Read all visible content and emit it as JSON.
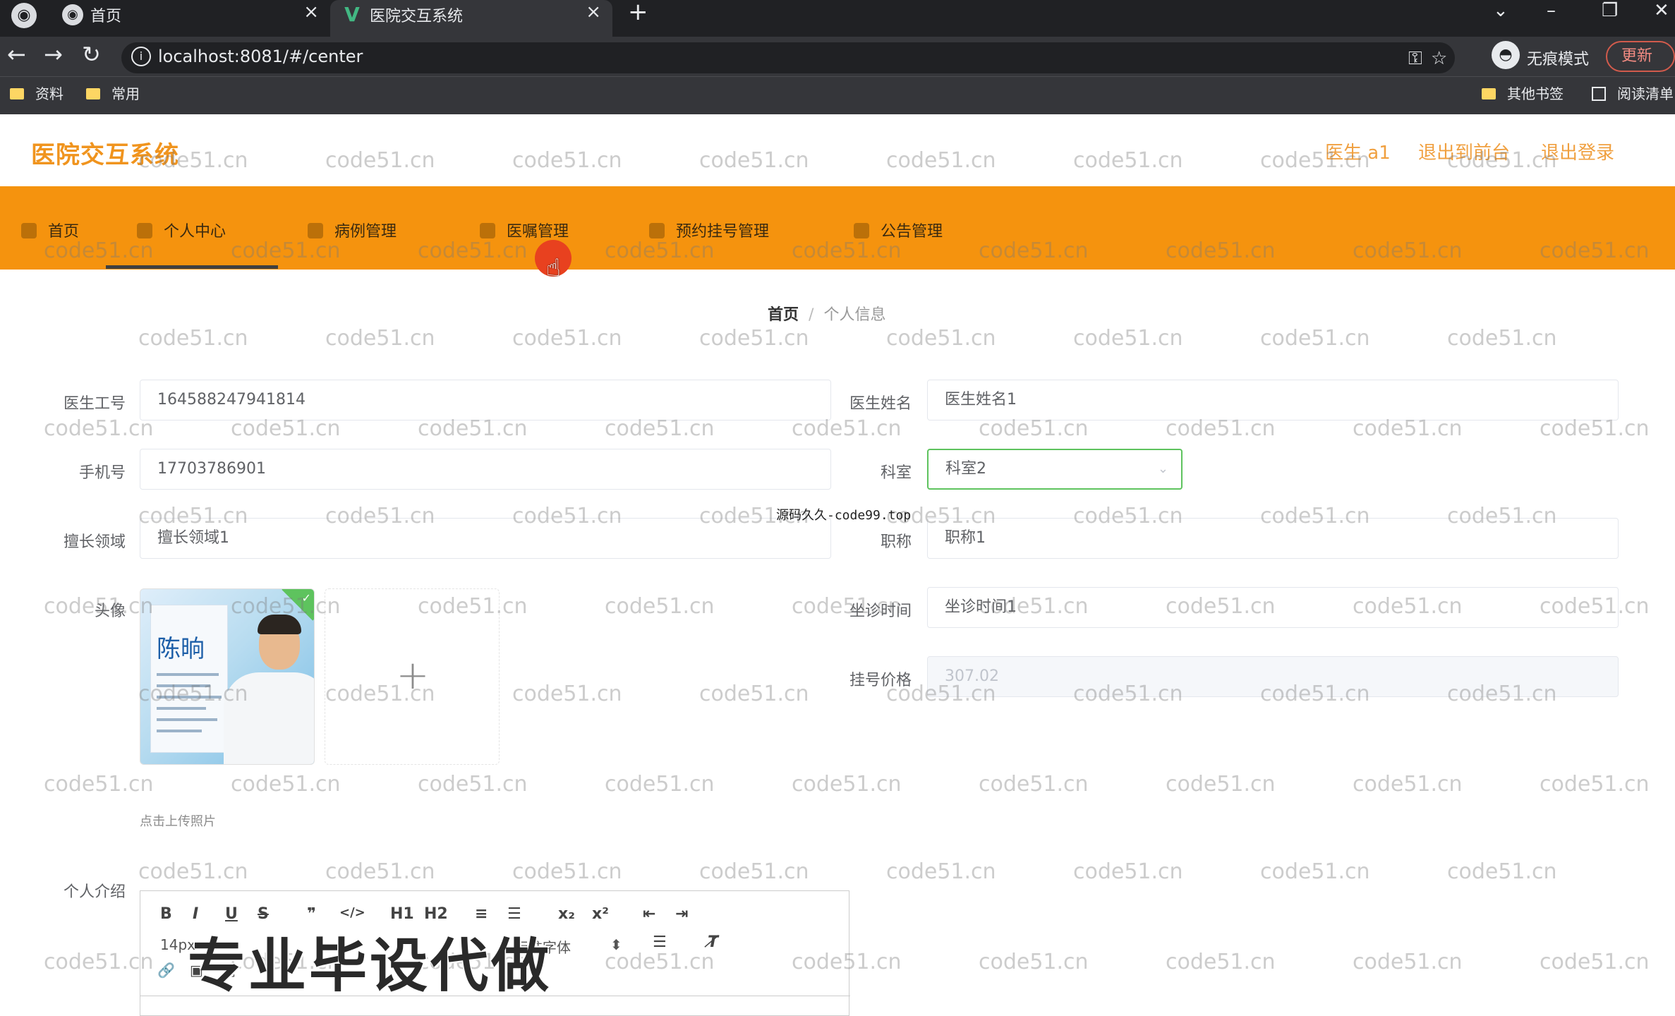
{
  "browser": {
    "tabs": [
      {
        "label": "首页",
        "close": "×"
      },
      {
        "label": "医院交互系统",
        "close": "×"
      }
    ],
    "new_tab": "+",
    "url": "localhost:8081/#/center",
    "incognito_label": "无痕模式",
    "update_label": "更新",
    "bookmarks": [
      "资料",
      "常用"
    ],
    "other_bookmarks": "其他书签",
    "reading_list": "阅读清单"
  },
  "header": {
    "brand": "医院交互系统",
    "user": "医生 a1",
    "to_front": "退出到前台",
    "logout": "退出登录"
  },
  "nav": [
    {
      "label": "首页"
    },
    {
      "label": "个人中心"
    },
    {
      "label": "病例管理"
    },
    {
      "label": "医嘱管理"
    },
    {
      "label": "预约挂号管理"
    },
    {
      "label": "公告管理"
    }
  ],
  "breadcrumb": {
    "home": "首页",
    "separator": "/",
    "current": "个人信息"
  },
  "form": {
    "doctor_id": {
      "label": "医生工号",
      "value": "164588247941814"
    },
    "doctor_name": {
      "label": "医生姓名",
      "value": "医生姓名1"
    },
    "phone": {
      "label": "手机号",
      "value": "17703786901"
    },
    "department": {
      "label": "科室",
      "value": "科室2"
    },
    "specialty": {
      "label": "擅长领域",
      "value": "擅长领域1"
    },
    "title": {
      "label": "职称",
      "value": "职称1"
    },
    "avatar": {
      "label": "头像",
      "tip": "点击上传照片",
      "plus": "+",
      "card_name": "陈晌",
      "check": "✓"
    },
    "clinic_time": {
      "label": "坐诊时间",
      "value": "坐诊时间1"
    },
    "fee": {
      "label": "挂号价格",
      "value": "307.02"
    },
    "intro": {
      "label": "个人介绍"
    }
  },
  "editor": {
    "toolbar_row1": [
      "B",
      "I",
      "U",
      "S",
      "❞",
      "</>",
      "H1",
      "H2",
      "≡",
      "☰",
      "x₂",
      "x²",
      "⇤",
      "⇥"
    ],
    "font_size": "14px",
    "font_family": "标准字体",
    "row3": [
      "🔗",
      "▣",
      "▤"
    ]
  },
  "overlays": {
    "watermark": "code51.cn",
    "center_text": "源码久久-code99.top",
    "banner": "专业毕设代做"
  },
  "colors": {
    "nav_bg": "#f5930e",
    "brand": "#f0941e",
    "focus": "#5ec35e"
  }
}
